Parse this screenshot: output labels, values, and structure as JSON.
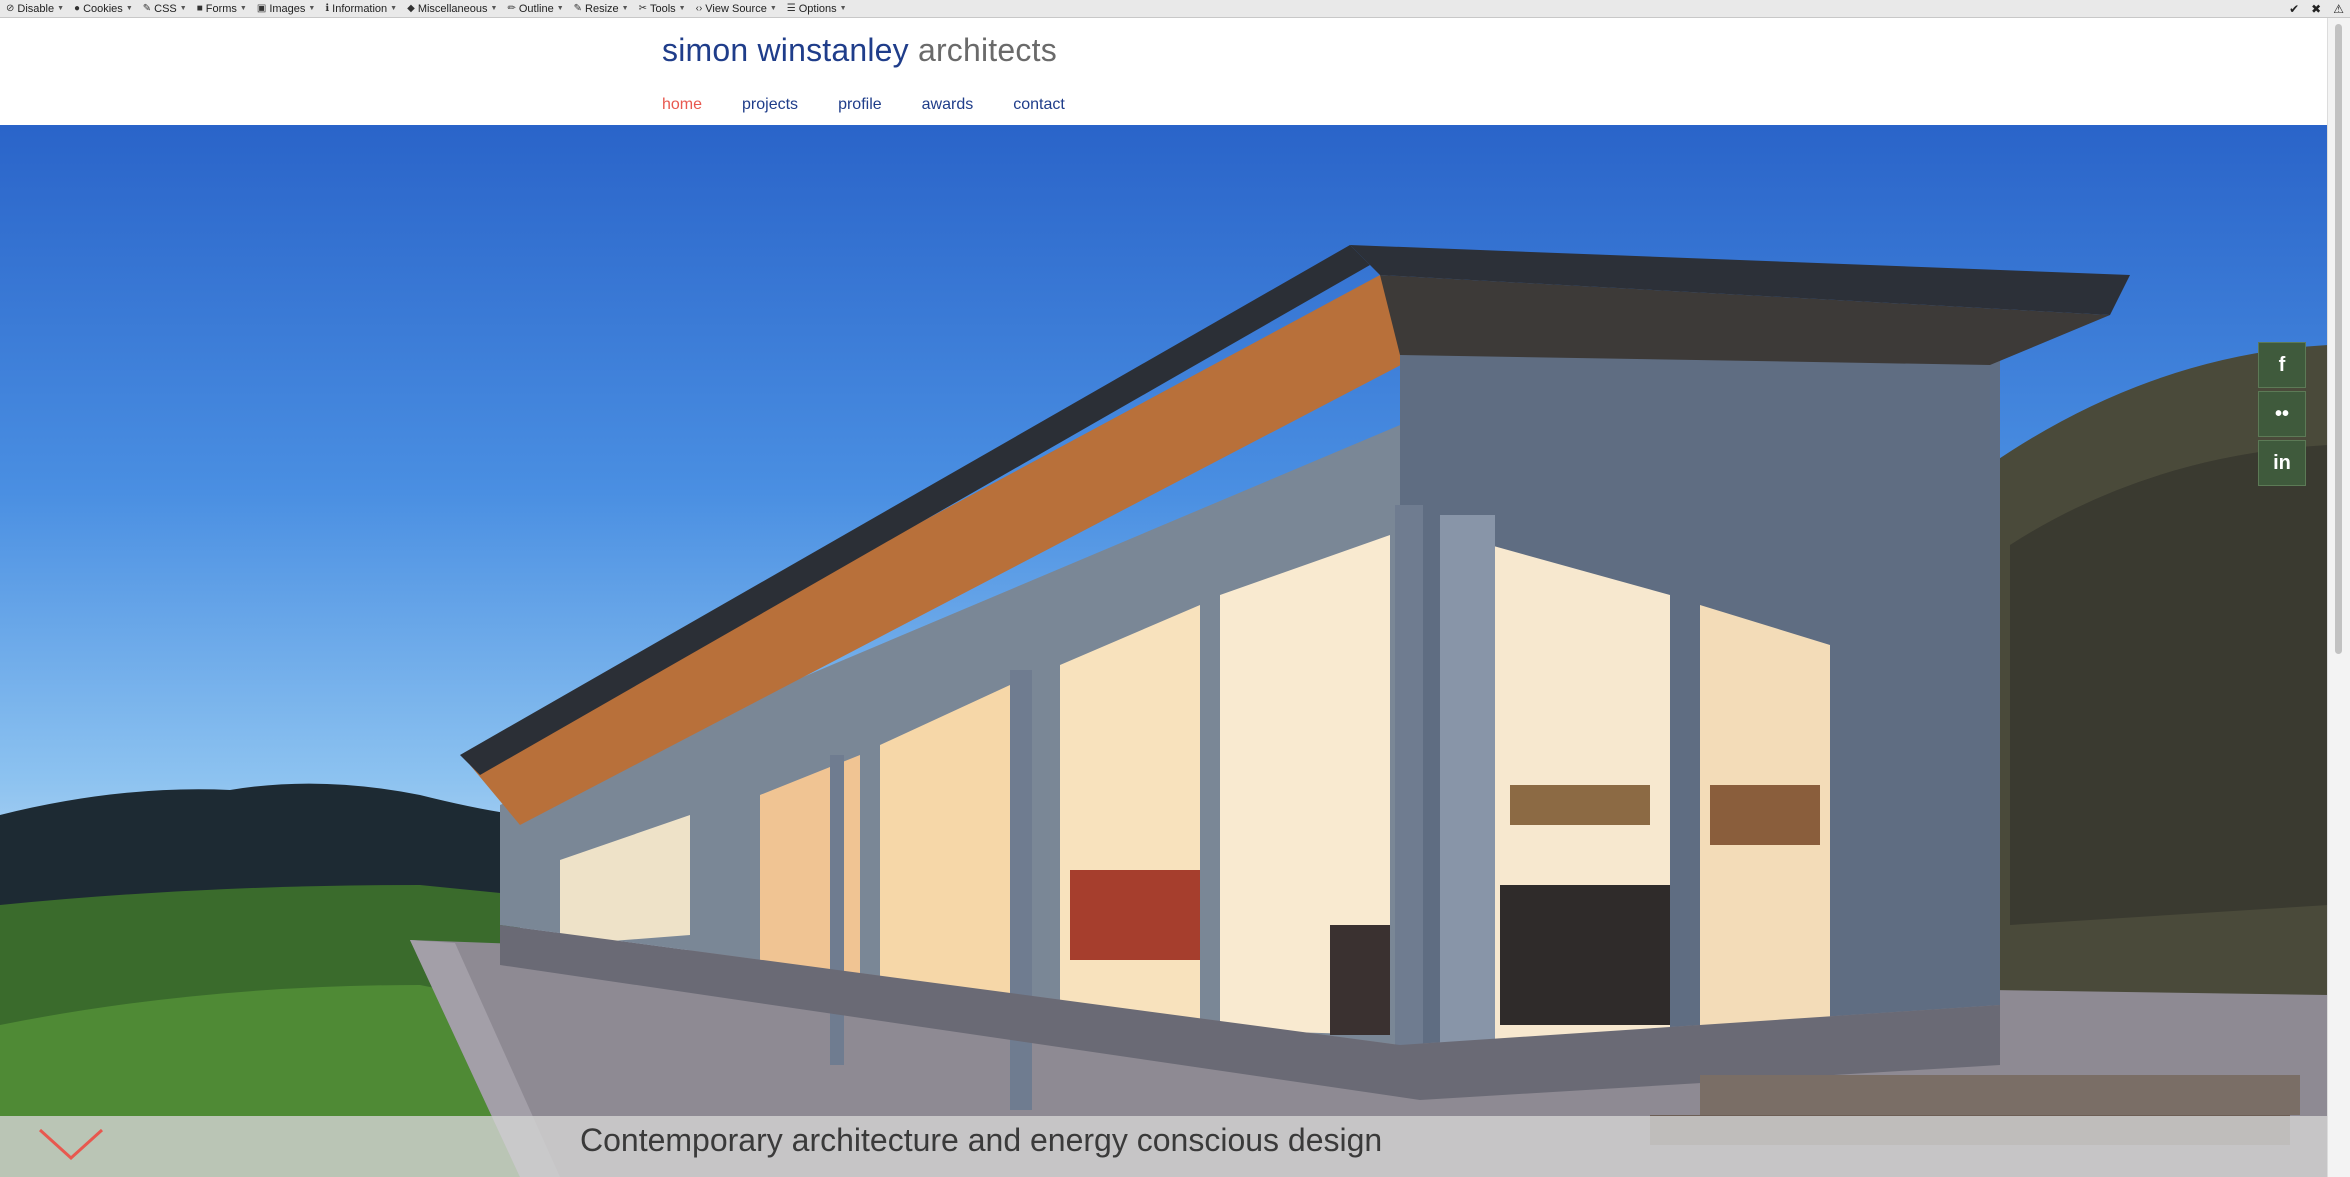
{
  "toolbar": {
    "items": [
      {
        "icon": "disable-icon",
        "label": "Disable"
      },
      {
        "icon": "cookies-icon",
        "label": "Cookies"
      },
      {
        "icon": "css-icon",
        "label": "CSS"
      },
      {
        "icon": "forms-icon",
        "label": "Forms"
      },
      {
        "icon": "images-icon",
        "label": "Images"
      },
      {
        "icon": "information-icon",
        "label": "Information"
      },
      {
        "icon": "miscellaneous-icon",
        "label": "Miscellaneous"
      },
      {
        "icon": "outline-icon",
        "label": "Outline"
      },
      {
        "icon": "resize-icon",
        "label": "Resize"
      },
      {
        "icon": "tools-icon",
        "label": "Tools"
      },
      {
        "icon": "view-source-icon",
        "label": "View Source"
      },
      {
        "icon": "options-icon",
        "label": "Options"
      }
    ],
    "right_icons": [
      "check-icon",
      "close-icon",
      "warning-icon"
    ]
  },
  "header": {
    "logo_name": "simon winstanley",
    "logo_sub": "architects",
    "nav": [
      {
        "label": "home",
        "active": true
      },
      {
        "label": "projects",
        "active": false
      },
      {
        "label": "profile",
        "active": false
      },
      {
        "label": "awards",
        "active": false
      },
      {
        "label": "contact",
        "active": false
      }
    ]
  },
  "social": [
    {
      "icon": "facebook-icon",
      "glyph": "f"
    },
    {
      "icon": "flickr-icon",
      "glyph": "••"
    },
    {
      "icon": "linkedin-icon",
      "glyph": "in"
    }
  ],
  "caption": {
    "text": "Contemporary architecture and energy conscious design"
  },
  "colors": {
    "brand_blue": "#1f3d8a",
    "nav_active": "#e8584f",
    "social_bg": "#3f5a3c"
  }
}
